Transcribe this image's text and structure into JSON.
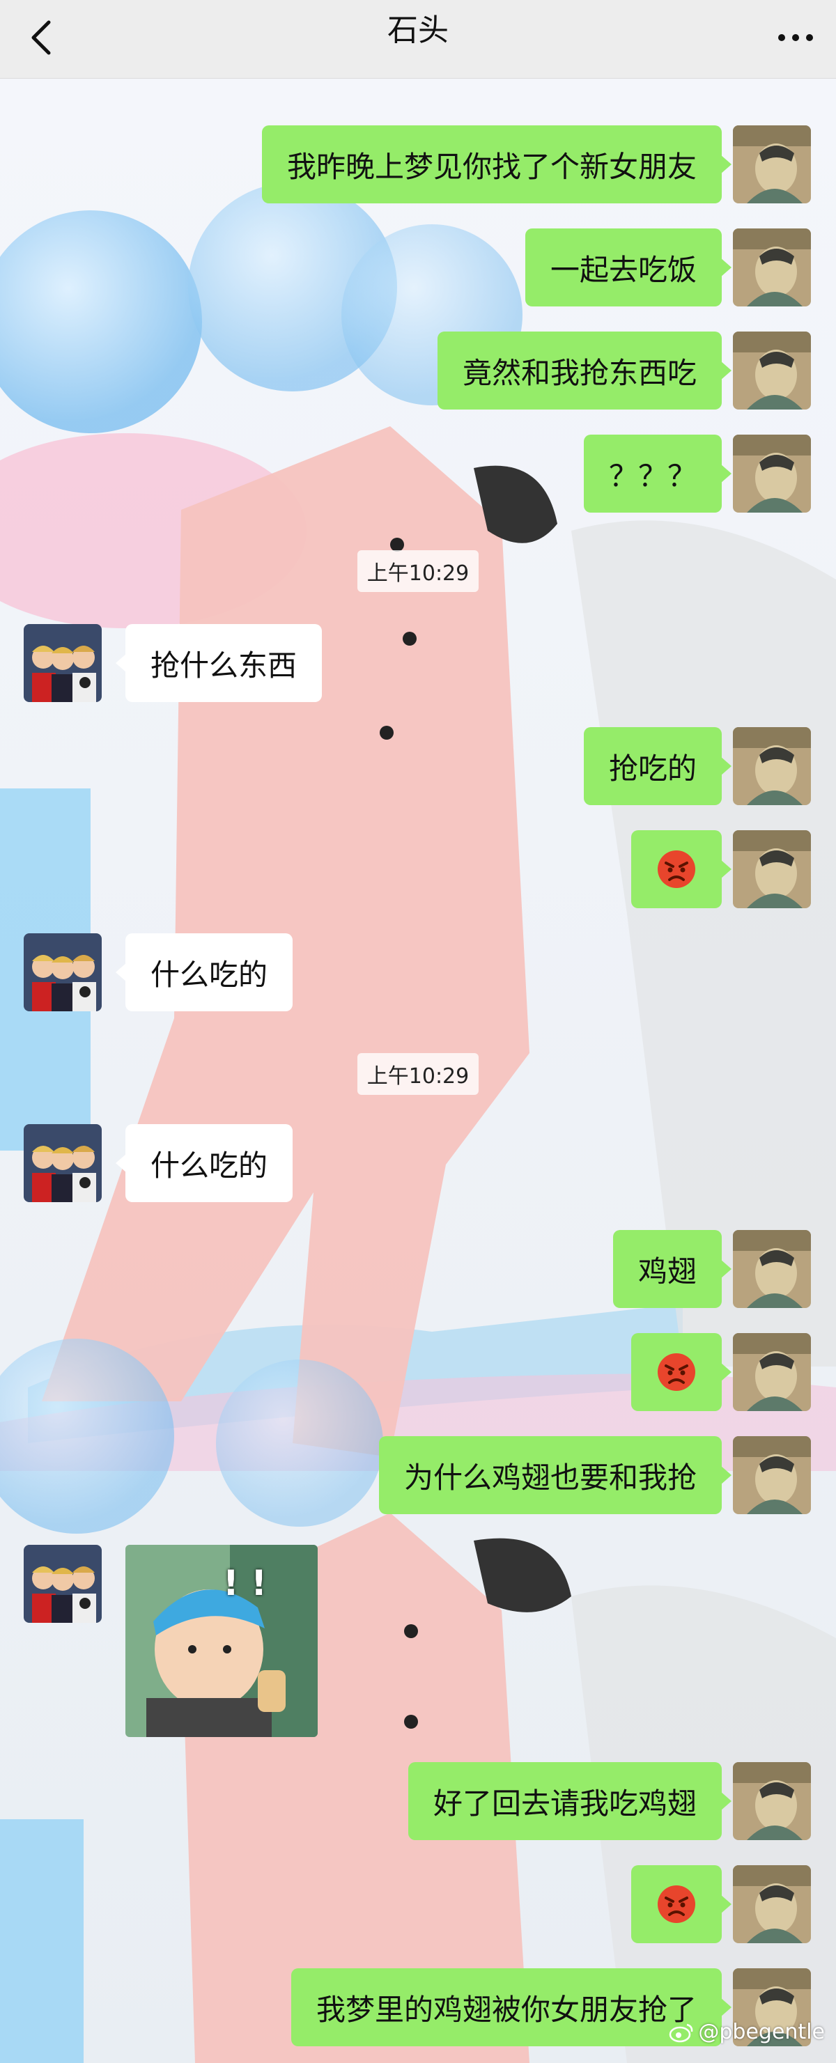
{
  "header": {
    "title": "石头",
    "back_icon": "chevron-left-icon",
    "more_icon": "ellipsis-icon"
  },
  "messages": [
    {
      "side": "right",
      "type": "text",
      "text": "我昨晚上梦见你找了个新女朋友"
    },
    {
      "side": "right",
      "type": "text",
      "text": "一起去吃饭"
    },
    {
      "side": "right",
      "type": "text",
      "text": "竟然和我抢东西吃"
    },
    {
      "side": "right",
      "type": "text",
      "text": "？？？"
    },
    {
      "type": "time",
      "text": "上午10:29"
    },
    {
      "side": "left",
      "type": "text",
      "text": "抢什么东西"
    },
    {
      "side": "right",
      "type": "text",
      "text": "抢吃的"
    },
    {
      "side": "right",
      "type": "emoji",
      "emoji": "angry-face-icon"
    },
    {
      "side": "left",
      "type": "text",
      "text": "什么吃的"
    },
    {
      "type": "time",
      "text": "上午10:29"
    },
    {
      "side": "left",
      "type": "text",
      "text": "什么吃的"
    },
    {
      "side": "right",
      "type": "text",
      "text": "鸡翅"
    },
    {
      "side": "right",
      "type": "emoji",
      "emoji": "angry-face-icon"
    },
    {
      "side": "right",
      "type": "text",
      "text": "为什么鸡翅也要和我抢"
    },
    {
      "side": "left",
      "type": "sticker",
      "sticker": "surprised-baby-sticker",
      "caption": "! !"
    },
    {
      "side": "right",
      "type": "text",
      "text": "好了回去请我吃鸡翅"
    },
    {
      "side": "right",
      "type": "emoji",
      "emoji": "angry-face-icon"
    },
    {
      "side": "right",
      "type": "text",
      "text": "我梦里的鸡翅被你女朋友抢了"
    }
  ],
  "watermark": {
    "text": "@pbegentle",
    "icon": "weibo-icon"
  },
  "colors": {
    "outgoing": "#95ec69",
    "incoming": "#ffffff",
    "header": "#ededed"
  }
}
